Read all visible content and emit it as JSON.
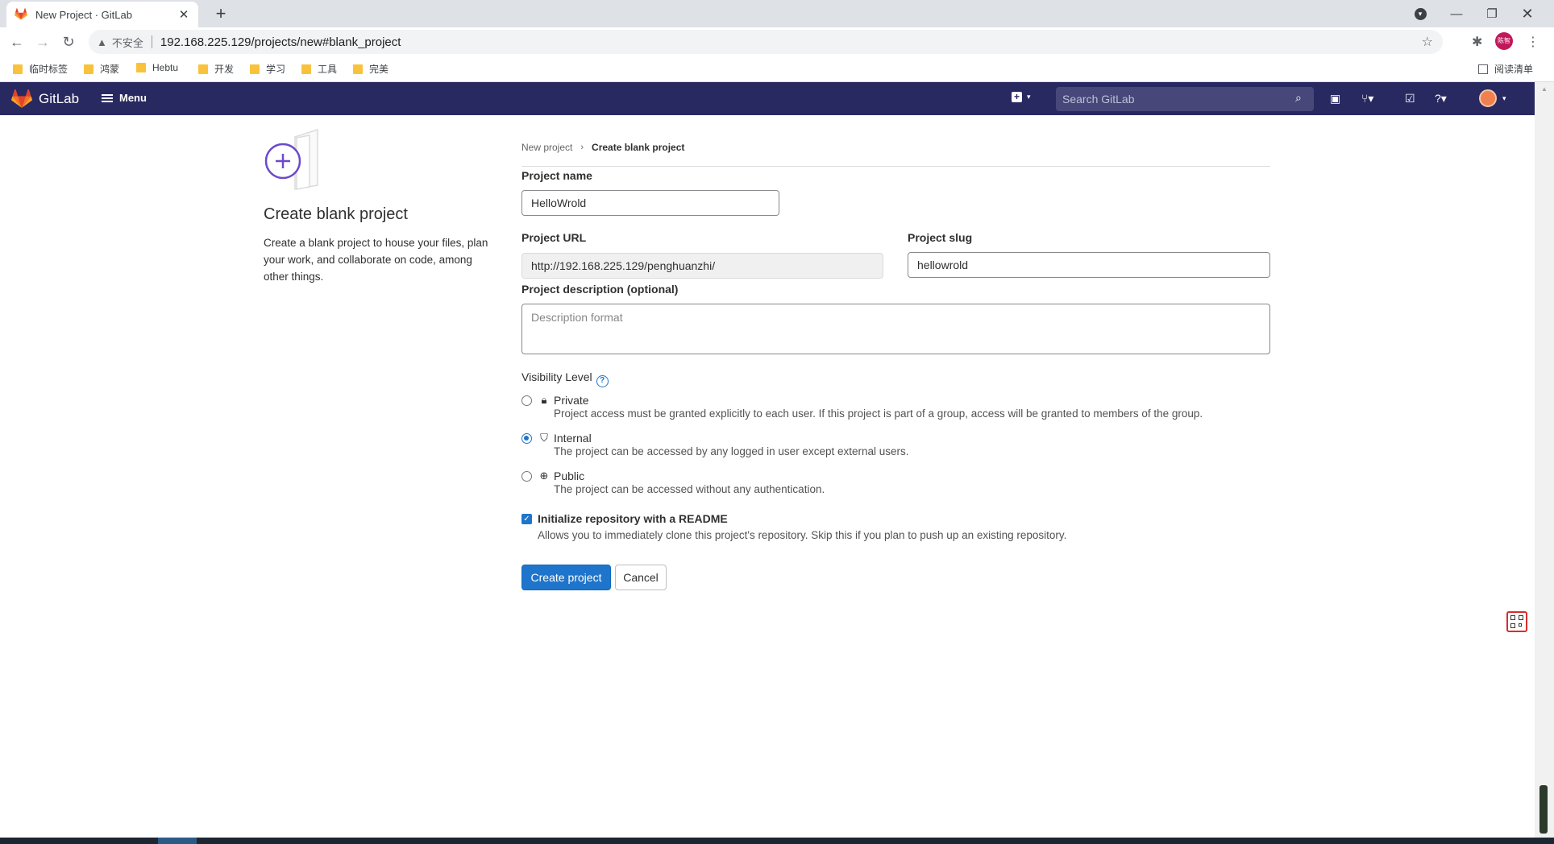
{
  "browser": {
    "tab_title": "New Project · GitLab",
    "tab_close": "✕",
    "new_tab": "+",
    "insecure_label": "不安全",
    "url": "192.168.225.129/projects/new#blank_project",
    "profile_text": "陈智",
    "bookmarks": [
      "临时标签",
      "鸿蒙",
      "Hebtu",
      "开发",
      "学习",
      "工具",
      "完美"
    ],
    "reading_list": "阅读清单"
  },
  "gitlab": {
    "brand": "GitLab",
    "menu_label": "Menu",
    "search_placeholder": "Search GitLab"
  },
  "left": {
    "title": "Create blank project",
    "description": "Create a blank project to house your files, plan your work, and collaborate on code, among other things."
  },
  "breadcrumb": {
    "parent": "New project",
    "current": "Create blank project"
  },
  "form": {
    "project_name_label": "Project name",
    "project_name_value": "HelloWrold",
    "project_url_label": "Project URL",
    "project_url_value": "http://192.168.225.129/penghuanzhi/",
    "project_slug_label": "Project slug",
    "project_slug_value": "hellowrold",
    "description_label": "Project description (optional)",
    "description_placeholder": "Description format",
    "visibility_label": "Visibility Level",
    "visibility_options": [
      {
        "name": "Private",
        "icon": "lock-icon",
        "description": "Project access must be granted explicitly to each user. If this project is part of a group, access will be granted to members of the group.",
        "selected": false
      },
      {
        "name": "Internal",
        "icon": "shield-icon",
        "description": "The project can be accessed by any logged in user except external users.",
        "selected": true
      },
      {
        "name": "Public",
        "icon": "globe-icon",
        "description": "The project can be accessed without any authentication.",
        "selected": false
      }
    ],
    "readme_label": "Initialize repository with a README",
    "readme_description": "Allows you to immediately clone this project's repository. Skip this if you plan to push up an existing repository.",
    "readme_checked": true,
    "create_button": "Create project",
    "cancel_button": "Cancel"
  },
  "colors": {
    "header_bg": "#292961",
    "primary": "#1f75cb",
    "illustration": "#6e49cb"
  }
}
